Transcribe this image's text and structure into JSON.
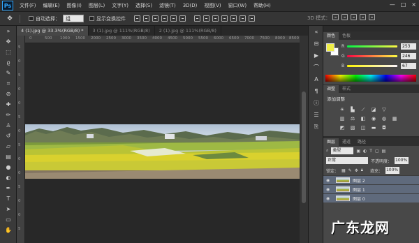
{
  "app": {
    "logo": "Ps"
  },
  "menu": [
    "文件(F)",
    "编辑(E)",
    "图像(I)",
    "图层(L)",
    "文字(Y)",
    "选择(S)",
    "滤镜(T)",
    "3D(D)",
    "视图(V)",
    "窗口(W)",
    "帮助(H)"
  ],
  "window_controls": {
    "minimize": "—",
    "restore": "□",
    "close": "×"
  },
  "options": {
    "auto_select_label": "自动选择：",
    "auto_select_value": "组",
    "show_transform_label": "显示变换控件",
    "mode3d_label": "3D 模式："
  },
  "tabs": [
    "4 (1).jpg @ 33.3%(RGB/8) *",
    "3 (1).jpg @ 111%(RGB/8)",
    "2 (1).jpg @ 111%(RGB/8)"
  ],
  "rulers": {
    "top": [
      "0",
      "500",
      "1000",
      "1500",
      "2000",
      "2500",
      "3000",
      "3500",
      "4000",
      "4500",
      "5000",
      "5500",
      "6000",
      "6500",
      "7000",
      "7500",
      "8000",
      "8500"
    ],
    "left": [
      "5",
      "0",
      "5",
      "0",
      "0",
      "5",
      "0",
      "5",
      "0",
      "0",
      "5",
      "0",
      "0",
      "5"
    ]
  },
  "panels": {
    "color_tab": "颜色",
    "swatch_tab": "色板",
    "adjust_tab": "调整",
    "style_tab": "样式",
    "adjust_title": "添加调整",
    "layers_tab": "图层",
    "channels_tab": "通道",
    "paths_tab": "路径"
  },
  "color": {
    "fg": "#f0ee47",
    "r_label": "R",
    "r_value": "253",
    "g_label": "G",
    "g_value": "246",
    "b_label": "B",
    "b_value": "67"
  },
  "layers": {
    "filter_kind": "类型",
    "blend_mode": "正常",
    "opacity_label": "不透明度：",
    "opacity_value": "100%",
    "lock_label": "锁定：",
    "fill_label": "填充：",
    "fill_value": "100%",
    "items": [
      {
        "name": "图层 2"
      },
      {
        "name": "图层 1"
      },
      {
        "name": "图层 0"
      }
    ]
  },
  "watermark": "广东龙网"
}
